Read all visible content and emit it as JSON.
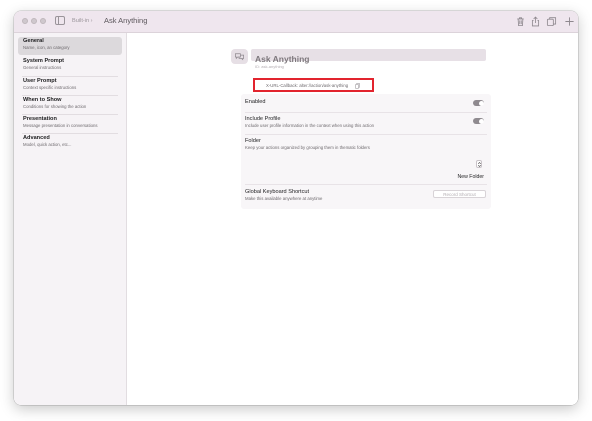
{
  "titlebar": {
    "breadcrumb": "Built-in ›",
    "title": "Ask Anything"
  },
  "sidebar": {
    "items": [
      {
        "label": "General",
        "sub": "Name, icon, an category"
      },
      {
        "label": "System Prompt",
        "sub": "General instructions"
      },
      {
        "label": "User Prompt",
        "sub": "Context specific instructions"
      },
      {
        "label": "When to Show",
        "sub": "Conditions for showing the action"
      },
      {
        "label": "Presentation",
        "sub": "Message presentation in conversations"
      },
      {
        "label": "Advanced",
        "sub": "Model, quick action, etc..."
      }
    ]
  },
  "action": {
    "name_value": "Ask Anything",
    "id_text": "ID: ask-anything",
    "url_text": "X-URL-Callback: alter://action/ask-anything"
  },
  "settings": {
    "enabled_label": "Enabled",
    "enabled_on": true,
    "include_profile_label": "Include Profile",
    "include_profile_sub": "Include user profile information in the context when using this action",
    "include_profile_on": true,
    "folder_label": "Folder",
    "folder_sub": "Keep your actions organized by grouping them in thematic folders",
    "new_folder_label": "New Folder",
    "shortcut_label": "Global Keyboard Shortcut",
    "shortcut_sub": "Make this available anywhere at anytime",
    "record_shortcut_label": "Record Shortcut"
  },
  "colors": {
    "titlebar_bg": "#efe6ee",
    "highlight_border": "#e2242e",
    "selected_item_bg": "#dcd9dc"
  },
  "icons": {
    "titlebar": [
      "sidebar-toggle-icon",
      "trash-icon",
      "share-icon",
      "duplicate-icon",
      "plus-icon"
    ],
    "action": "chat-bubbles-icon",
    "url_copy": "copy-icon"
  }
}
